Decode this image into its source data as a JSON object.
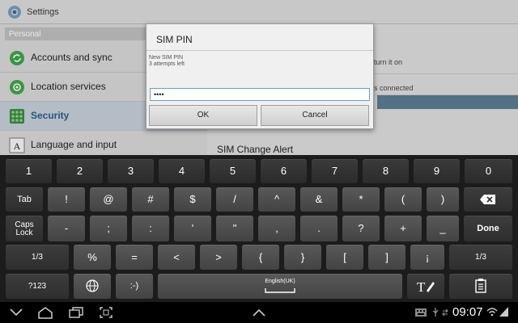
{
  "titlebar": {
    "title": "Settings"
  },
  "sidebar": {
    "section": "Personal",
    "items": [
      {
        "label": "Accounts and sync"
      },
      {
        "label": "Location services"
      },
      {
        "label": "Security"
      },
      {
        "label": "Language and input"
      }
    ]
  },
  "background_pane": {
    "text1": "turn it on",
    "text2": "s connected",
    "item_title": "SIM Change Alert"
  },
  "dialog": {
    "title": "SIM PIN",
    "message_line1": "New SIM PIN",
    "message_line2": "3 attempts left",
    "input_value": "••••",
    "ok_label": "OK",
    "cancel_label": "Cancel"
  },
  "keyboard": {
    "row1": [
      "1",
      "2",
      "3",
      "4",
      "5",
      "6",
      "7",
      "8",
      "9",
      "0"
    ],
    "row2": [
      "Tab",
      "!",
      "@",
      "#",
      "$",
      "/",
      "^",
      "&",
      "*",
      "(",
      ")",
      "⌫"
    ],
    "row3": [
      "Caps Lock",
      "-",
      ";",
      ":",
      "'",
      "\"",
      ",",
      ".",
      "?",
      "+",
      "_",
      "Done"
    ],
    "row4": [
      "1/3",
      "%",
      "=",
      "<",
      ">",
      "{",
      "}",
      "[",
      "]",
      "¡",
      "1/3"
    ],
    "row5": [
      "?123",
      "🌐",
      ":-)",
      "English(UK)",
      "T✎",
      "☰"
    ],
    "space_label": "English(UK)"
  },
  "statusbar": {
    "time": "09:07"
  },
  "colors": {
    "accent": "#5b7a90",
    "selected_text": "#2a5e8a",
    "keyboard_bg": "#1c1c1c"
  }
}
